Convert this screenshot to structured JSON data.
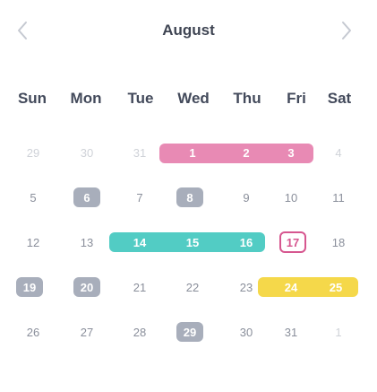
{
  "calendar": {
    "month": "August",
    "prev_icon": "chevron-left-icon",
    "next_icon": "chevron-right-icon"
  },
  "weekdays": [
    "Sun",
    "Mon",
    "Tue",
    "Wed",
    "Thu",
    "Fri",
    "Sat"
  ],
  "weeks": [
    [
      "29",
      "30",
      "31",
      "1",
      "2",
      "3",
      "4"
    ],
    [
      "5",
      "6",
      "7",
      "8",
      "9",
      "10",
      "11"
    ],
    [
      "12",
      "13",
      "14",
      "15",
      "16",
      "17",
      "18"
    ],
    [
      "19",
      "20",
      "21",
      "22",
      "23",
      "24",
      "25"
    ],
    [
      "26",
      "27",
      "28",
      "29",
      "30",
      "31",
      "1"
    ]
  ],
  "colors": {
    "pink": "#e88ab4",
    "teal": "#52ccc4",
    "yellow": "#f5d84a",
    "gray_pill": "#a8aebb",
    "today_ring": "#d6568f"
  }
}
